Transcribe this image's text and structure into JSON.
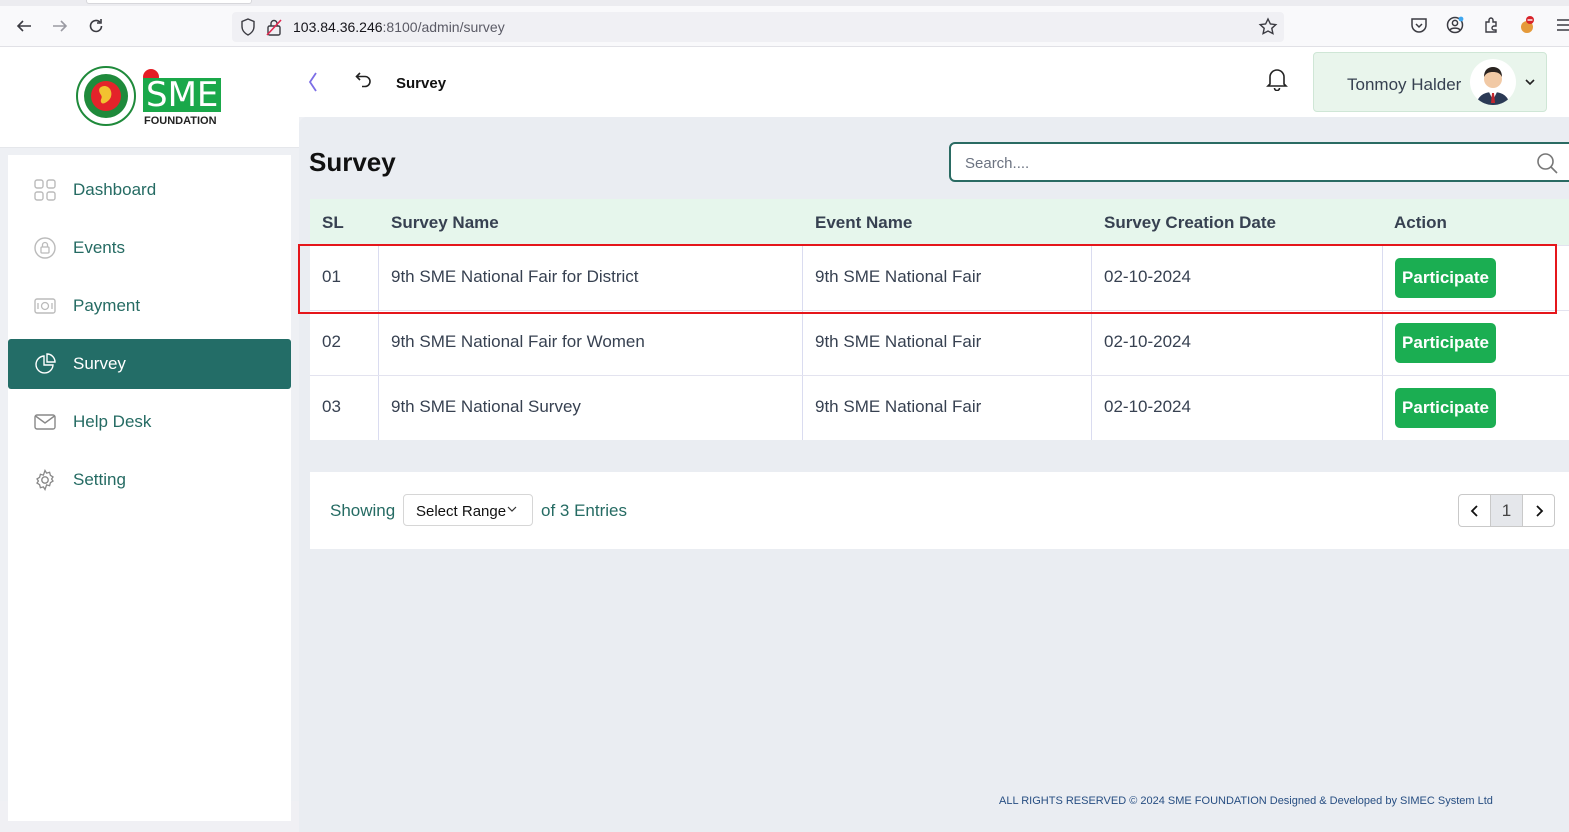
{
  "browser": {
    "url_host": "103.84.36.246",
    "url_rest": ":8100/admin/survey"
  },
  "brand": {
    "logo_text": "SME",
    "logo_subtext": "FOUNDATION"
  },
  "sidebar": {
    "items": [
      {
        "label": "Dashboard",
        "icon": "grid-icon"
      },
      {
        "label": "Events",
        "icon": "lock-circle-icon"
      },
      {
        "label": "Payment",
        "icon": "cash-icon"
      },
      {
        "label": "Survey",
        "icon": "pie-chart-icon",
        "active": true
      },
      {
        "label": "Help Desk",
        "icon": "mail-icon"
      },
      {
        "label": "Setting",
        "icon": "gear-icon"
      }
    ]
  },
  "header": {
    "breadcrumb": "Survey",
    "user_name": "Tonmoy Halder"
  },
  "main": {
    "title": "Survey",
    "search_placeholder": "Search....",
    "columns": [
      "SL",
      "Survey Name",
      "Event Name",
      "Survey Creation Date",
      "Action"
    ],
    "rows": [
      {
        "sl": "01",
        "survey": "9th SME National Fair for District",
        "event": "9th SME National Fair",
        "date": "02-10-2024",
        "action": "Participate"
      },
      {
        "sl": "02",
        "survey": "9th SME National Fair for Women",
        "event": "9th SME National Fair",
        "date": "02-10-2024",
        "action": "Participate"
      },
      {
        "sl": "03",
        "survey": "9th SME National Survey",
        "event": "9th SME National Fair",
        "date": "02-10-2024",
        "action": "Participate"
      }
    ],
    "pagination": {
      "showing_label": "Showing",
      "range_label": "Select Range",
      "of_label": "of 3 Entries",
      "current_page": "1"
    }
  },
  "footer": {
    "text": "ALL RIGHTS RESERVED © 2024 SME FOUNDATION   Designed & Developed by SIMEC System Ltd"
  },
  "colors": {
    "primary": "#236d67",
    "accent_green": "#1bae52",
    "header_row": "#e6f6ec",
    "highlight": "#e5161b"
  }
}
